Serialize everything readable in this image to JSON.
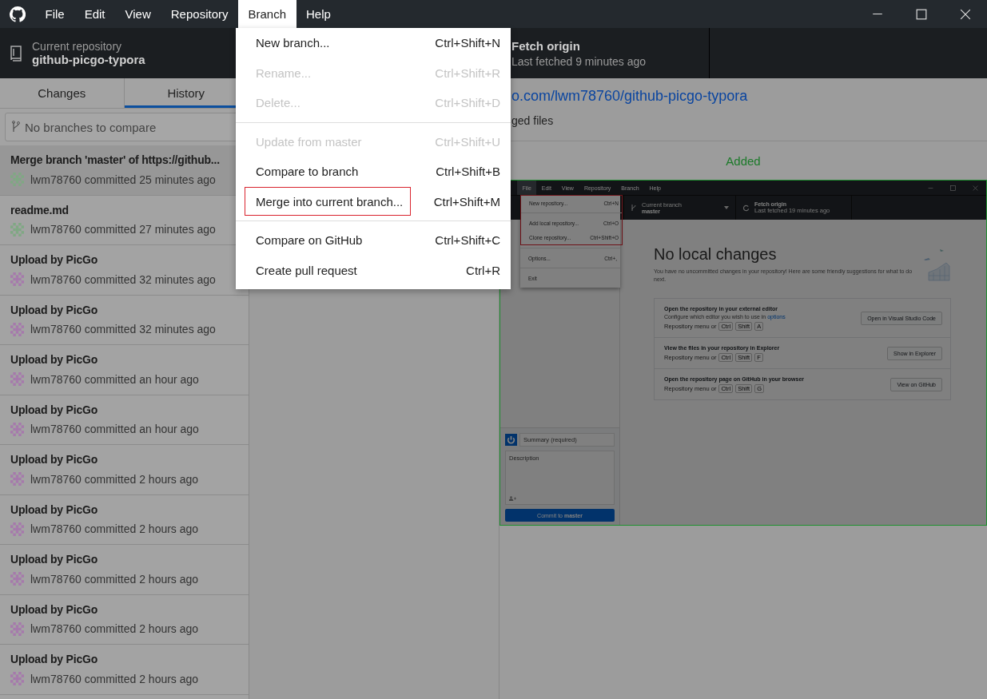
{
  "menubar": {
    "items": [
      {
        "label": "File",
        "selected": false
      },
      {
        "label": "Edit",
        "selected": false
      },
      {
        "label": "View",
        "selected": false
      },
      {
        "label": "Repository",
        "selected": false
      },
      {
        "label": "Branch",
        "selected": true
      },
      {
        "label": "Help",
        "selected": false
      }
    ]
  },
  "toolbar": {
    "repository": {
      "caption": "Current repository",
      "name": "github-picgo-typora"
    },
    "fetch": {
      "title": "Fetch origin",
      "subtitle": "Last fetched 9 minutes ago"
    }
  },
  "sidebar": {
    "tabs": [
      {
        "label": "Changes",
        "selected": false
      },
      {
        "label": "History",
        "selected": true
      }
    ],
    "compare": {
      "placeholder": "No branches to compare"
    },
    "commits": [
      {
        "title": "Merge branch 'master' of https://github...",
        "byline": "lwm78760 committed 25 minutes ago",
        "color": "#7fa883",
        "selected": true
      },
      {
        "title": "readme.md",
        "byline": "lwm78760 committed 27 minutes ago",
        "color": "#7fa883",
        "selected": false
      },
      {
        "title": "Upload by PicGo",
        "byline": "lwm78760 committed 32 minutes ago",
        "color": "#a679ac",
        "selected": false
      },
      {
        "title": "Upload by PicGo",
        "byline": "lwm78760 committed 32 minutes ago",
        "color": "#a679ac",
        "selected": false
      },
      {
        "title": "Upload by PicGo",
        "byline": "lwm78760 committed an hour ago",
        "color": "#a679ac",
        "selected": false
      },
      {
        "title": "Upload by PicGo",
        "byline": "lwm78760 committed an hour ago",
        "color": "#a679ac",
        "selected": false
      },
      {
        "title": "Upload by PicGo",
        "byline": "lwm78760 committed 2 hours ago",
        "color": "#a679ac",
        "selected": false
      },
      {
        "title": "Upload by PicGo",
        "byline": "lwm78760 committed 2 hours ago",
        "color": "#a679ac",
        "selected": false
      },
      {
        "title": "Upload by PicGo",
        "byline": "lwm78760 committed 2 hours ago",
        "color": "#a679ac",
        "selected": false
      },
      {
        "title": "Upload by PicGo",
        "byline": "lwm78760 committed 2 hours ago",
        "color": "#a679ac",
        "selected": false
      },
      {
        "title": "Upload by PicGo",
        "byline": "lwm78760 committed 2 hours ago",
        "color": "#a679ac",
        "selected": false
      }
    ]
  },
  "commit_header": {
    "link": "o.com/lwm78760/github-picgo-typora",
    "files": "ged files"
  },
  "diff": {
    "status": "Added",
    "screenshot": {
      "menubar": {
        "items": [
          {
            "label": "File",
            "selected": true
          },
          {
            "label": "Edit",
            "selected": false
          },
          {
            "label": "View",
            "selected": false
          },
          {
            "label": "Repository",
            "selected": false
          },
          {
            "label": "Branch",
            "selected": false
          },
          {
            "label": "Help",
            "selected": false
          }
        ]
      },
      "toolbar": {
        "branch": {
          "caption": "Current branch",
          "name": "master"
        },
        "fetch": {
          "title": "Fetch origin",
          "subtitle": "Last fetched 19 minutes ago"
        }
      },
      "file_menu": {
        "blocks": [
          {
            "outlined": true,
            "items": [
              {
                "kind": "item",
                "label": "New repository...",
                "shortcut": "Ctrl+N"
              },
              {
                "kind": "separator"
              },
              {
                "kind": "item",
                "label": "Add local repository...",
                "shortcut": "Ctrl+O"
              },
              {
                "kind": "item",
                "label": "Clone repository...",
                "shortcut": "Ctrl+Shift+O"
              }
            ]
          },
          {
            "outlined": false,
            "items": [
              {
                "kind": "separator"
              },
              {
                "kind": "item",
                "label": "Options...",
                "shortcut": "Ctrl+,"
              },
              {
                "kind": "separator"
              },
              {
                "kind": "item",
                "label": "Exit"
              }
            ]
          }
        ]
      },
      "commit_box": {
        "summary_placeholder": "Summary (required)",
        "description_placeholder": "Description",
        "button": "Commit to **master**"
      },
      "no_changes": {
        "title": "No local changes",
        "text": "You have no uncommitted changes in your repository! Here are some friendly suggestions for what to do next.",
        "actions": [
          {
            "title": "Open the repository in your external editor",
            "description": "Configure which editor you wish to use in",
            "link": "options",
            "hint": "Repository menu or",
            "keys": [
              "Ctrl",
              "Shift",
              "A"
            ],
            "button": "Open in Visual Studio Code"
          },
          {
            "title": "View the files in your repository in Explorer",
            "hint": "Repository menu or",
            "keys": [
              "Ctrl",
              "Shift",
              "F"
            ],
            "button": "Show in Explorer"
          },
          {
            "title": "Open the repository page on GitHub in your browser",
            "hint": "Repository menu or",
            "keys": [
              "Ctrl",
              "Shift",
              "G"
            ],
            "button": "View on GitHub"
          }
        ]
      }
    }
  },
  "branch_menu": {
    "items": [
      {
        "kind": "item",
        "label": "New branch...",
        "shortcut": "Ctrl+Shift+N",
        "disabled": false,
        "outlined": false
      },
      {
        "kind": "item",
        "label": "Rename...",
        "shortcut": "Ctrl+Shift+R",
        "disabled": true,
        "outlined": false
      },
      {
        "kind": "item",
        "label": "Delete...",
        "shortcut": "Ctrl+Shift+D",
        "disabled": true,
        "outlined": false
      },
      {
        "kind": "separator"
      },
      {
        "kind": "item",
        "label": "Update from master",
        "shortcut": "Ctrl+Shift+U",
        "disabled": true,
        "outlined": false
      },
      {
        "kind": "item",
        "label": "Compare to branch",
        "shortcut": "Ctrl+Shift+B",
        "disabled": false,
        "outlined": false
      },
      {
        "kind": "item",
        "label": "Merge into current branch...",
        "shortcut": "Ctrl+Shift+M",
        "disabled": false,
        "outlined": true
      },
      {
        "kind": "separator"
      },
      {
        "kind": "item",
        "label": "Compare on GitHub",
        "shortcut": "Ctrl+Shift+C",
        "disabled": false,
        "outlined": false
      },
      {
        "kind": "item",
        "label": "Create pull request",
        "shortcut": "Ctrl+R",
        "disabled": false,
        "outlined": false
      }
    ]
  }
}
